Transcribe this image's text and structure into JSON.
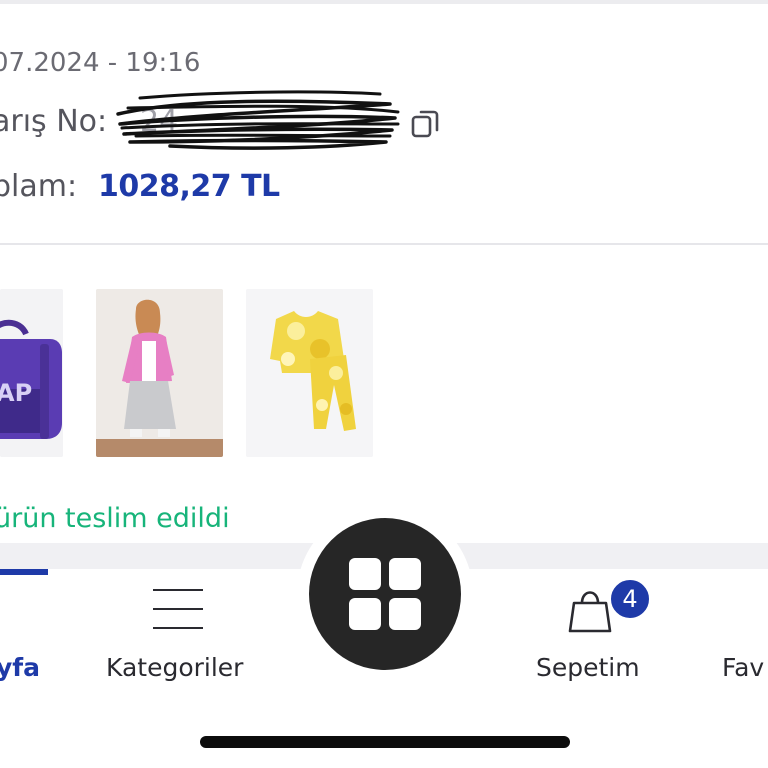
{
  "order": {
    "date": "07.2024 - 19:16",
    "order_no_label": "arış No:",
    "order_no_value": "24",
    "total_label": "plam:",
    "total_value": "1028,27 TL"
  },
  "products": [
    {
      "name": "backpack-thumbnail",
      "icon": "purple-backpack",
      "text": "AP"
    },
    {
      "name": "woman-outfit-thumbnail",
      "icon": "pink-jacket-outfit"
    },
    {
      "name": "kids-pajama-thumbnail",
      "icon": "yellow-tie-dye-set"
    }
  ],
  "delivery_status": "ürün teslim edildi",
  "nav": {
    "home_label": "yfa",
    "categories_label": "Kategoriler",
    "cart_label": "Sepetim",
    "cart_badge": "4",
    "favorites_label": "Fav"
  },
  "colors": {
    "brand_blue": "#1e3aa8",
    "success_green": "#17b47a",
    "fab_dark": "#262626"
  }
}
